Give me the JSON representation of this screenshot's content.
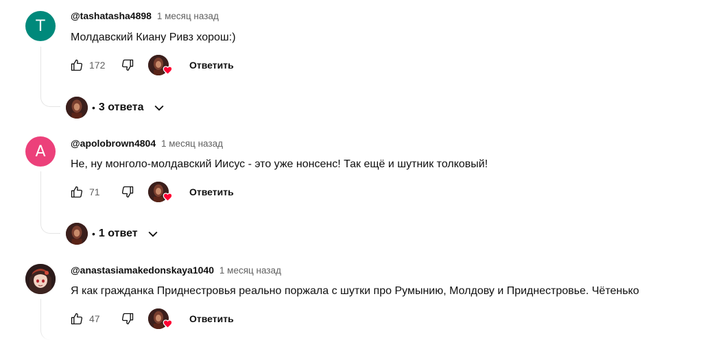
{
  "comments": [
    {
      "author": "@tashatasha4898",
      "time": "1 месяц назад",
      "text": "Молдавский Киану Ривз  хорош:)",
      "likes": "172",
      "avatar_letter": "T",
      "avatar_color": "#00897b",
      "reply_label": "Ответить",
      "replies_label": "3 ответа"
    },
    {
      "author": "@apolobrown4804",
      "time": "1 месяц назад",
      "text": "Не, ну монголо-молдавский Иисус - это уже нонсенс! Так ещё и шутник толковый!",
      "likes": "71",
      "avatar_letter": "A",
      "avatar_color": "#ec407a",
      "reply_label": "Ответить",
      "replies_label": "1 ответ"
    },
    {
      "author": "@anastasiamakedonskaya1040",
      "time": "1 месяц назад",
      "text": "Я как гражданка Приднестровья реально поржала с шутки про Румынию, Молдову и Приднестровье. Чётенько",
      "likes": "47",
      "avatar_letter": "",
      "avatar_color": "#2b1a1a",
      "reply_label": "Ответить"
    }
  ],
  "icons": {
    "like": "thumbs-up-icon",
    "dislike": "thumbs-down-icon",
    "heart": "heart-icon",
    "expand": "chevron-down-icon"
  },
  "colors": {
    "heart": "#ff0033",
    "secondary_text": "#606060"
  }
}
